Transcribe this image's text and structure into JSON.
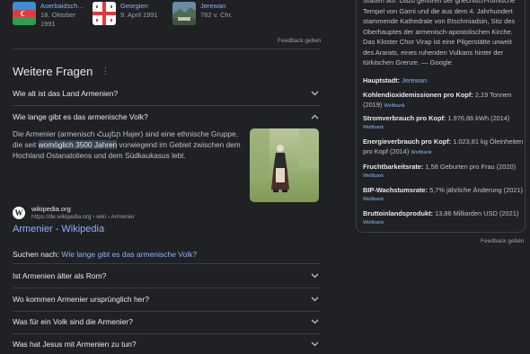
{
  "related": [
    {
      "name": "Aserbaidsch…",
      "sub": "18. Oktober 1991"
    },
    {
      "name": "Georgien",
      "sub": "9. April 1991"
    },
    {
      "name": "Jerewan",
      "sub": "782 v. Chr."
    }
  ],
  "feedback_label": "Feedback geben",
  "faq": {
    "title": "Weitere Fragen",
    "q1": "Wie alt ist das Land Armenien?",
    "q2": "Wie lange gibt es das armenische Volk?",
    "answer_pre": "Die Armenier (armenisch Հայեր Hajer) sind eine ethnische Gruppe, die seit ",
    "answer_highlight": "womöglich 3500 Jahren",
    "answer_post": " vorwiegend im Gebiet zwischen dem Hochland Ostanatoliens und dem Südkaukasus lebt.",
    "source_site": "wikipedia.org",
    "source_url": "https://de.wikipedia.org › wiki › Armenier",
    "source_title": "Armenier - Wikipedia",
    "search_prefix": "Suchen nach: ",
    "search_link": "Wie lange gibt es das armenische Volk?",
    "q3": "Ist Armenien älter als Rom?",
    "q4": "Wo kommen Armenier ursprünglich her?",
    "q5": "Was für ein Volk sind die Armenier?",
    "q6": "Was hat Jesus mit Armenien zu tun?"
  },
  "panel": {
    "description": "Stätten auf. Dazu gehören der griechisch-römische Tempel von Garni und die aus dem 4. Jahrhundert stammende Kathedrale von Etschmiadsin, Sitz des Oberhauptes der armenisch-apostolischen Kirche. Das Kloster Chor Virap ist eine Pilgerstätte unweit des Ararats, eines ruhenden Vulkans hinter der türkischen Grenze. — Google",
    "capital_label": "Hauptstadt:",
    "capital_value": "Jerewan",
    "facts": [
      {
        "label": "Kohlendioxidemissionen pro Kopf:",
        "value": "2,19 Tonnen (2019)",
        "source": "Weltbank"
      },
      {
        "label": "Stromverbrauch pro Kopf:",
        "value": "1.976,86 kWh (2014)",
        "source": "Weltbank"
      },
      {
        "label": "Energieverbrauch pro Kopf:",
        "value": "1.023,81 kg Öleinheiten pro Kopf (2014)",
        "source": "Weltbank"
      },
      {
        "label": "Fruchtbarkeitsrate:",
        "value": "1,58 Geburten pro Frau (2020)",
        "source": "Weltbank"
      },
      {
        "label": "BIP-Wachstumsrate:",
        "value": "5,7% jährliche Änderung (2021)",
        "source": "Weltbank"
      },
      {
        "label": "Bruttoinlandsprodukt:",
        "value": "13,86 Milliarden USD (2021)",
        "source": "Weltbank"
      }
    ]
  }
}
